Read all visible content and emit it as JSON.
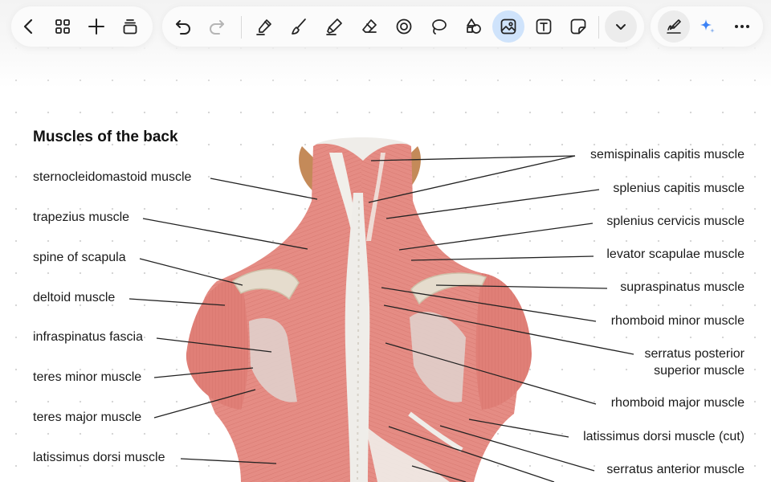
{
  "toolbar": {
    "left_tools": [
      {
        "icon": "back-icon"
      },
      {
        "icon": "grid-icon"
      },
      {
        "icon": "add-icon"
      },
      {
        "icon": "pages-icon"
      }
    ],
    "edit_tools": [
      {
        "icon": "undo-icon"
      },
      {
        "icon": "redo-icon"
      }
    ],
    "draw_tools": [
      {
        "icon": "pen-icon"
      },
      {
        "icon": "brush-icon"
      },
      {
        "icon": "highlighter-icon"
      },
      {
        "icon": "eraser-icon"
      },
      {
        "icon": "laser-pointer-icon"
      },
      {
        "icon": "lasso-icon"
      },
      {
        "icon": "shapes-icon"
      },
      {
        "icon": "image-icon",
        "active": true
      },
      {
        "icon": "text-box-icon"
      },
      {
        "icon": "sticky-note-icon"
      }
    ],
    "more_tools": {
      "icon": "chevron-down-icon"
    },
    "right_tools": [
      {
        "icon": "handwriting-icon"
      },
      {
        "icon": "ai-sparkle-icon"
      },
      {
        "icon": "more-icon"
      }
    ],
    "accent_color": "#cfe3fb"
  },
  "figure": {
    "title": "Muscles of the back",
    "left_labels": [
      "sternocleidomastoid muscle",
      "trapezius muscle",
      "spine of scapula",
      "deltoid muscle",
      "infraspinatus fascia",
      "teres minor muscle",
      "teres major muscle",
      "latissimus dorsi muscle"
    ],
    "right_labels": [
      "semispinalis capitis muscle",
      "splenius capitis muscle",
      "splenius cervicis muscle",
      "levator scapulae muscle",
      "supraspinatus muscle",
      "rhomboid minor muscle",
      "serratus posterior",
      "superior muscle",
      "rhomboid major muscle",
      "latissimus dorsi muscle (cut)",
      "serratus anterior muscle"
    ],
    "muscle_color": "#e58c84",
    "tendon_color": "#eeece8",
    "bone_color": "#e5dccd"
  }
}
